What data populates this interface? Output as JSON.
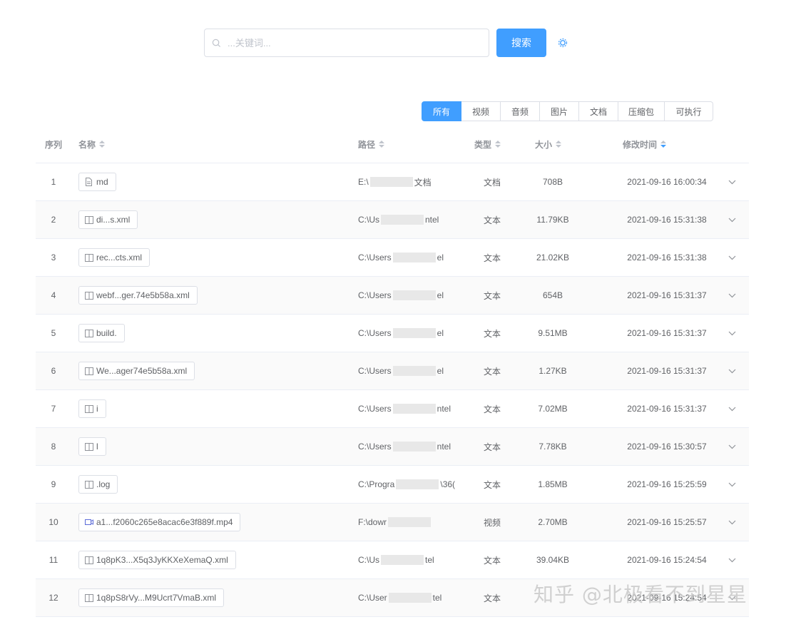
{
  "search": {
    "placeholder": "...关键词...",
    "button_label": "搜索"
  },
  "filters": [
    "所有",
    "视频",
    "音频",
    "图片",
    "文档",
    "压缩包",
    "可执行"
  ],
  "active_filter": "所有",
  "table": {
    "headers": {
      "index": "序列",
      "name": "名称",
      "path": "路径",
      "type": "类型",
      "size": "大小",
      "modified": "修改时间"
    },
    "rows": [
      {
        "idx": "1",
        "icon": "document-icon",
        "name": "md",
        "path": "E:\\",
        "path_tail": "文档",
        "type": "文档",
        "size": "708B",
        "time": "2021-09-16 16:00:34"
      },
      {
        "idx": "2",
        "icon": "text-file-icon",
        "name": "di...s.xml",
        "path": "C:\\Us",
        "path_tail": "ntel",
        "type": "文本",
        "size": "11.79KB",
        "time": "2021-09-16 15:31:38"
      },
      {
        "idx": "3",
        "icon": "text-file-icon",
        "name": "rec...cts.xml",
        "path": "C:\\Users",
        "path_tail": "el",
        "type": "文本",
        "size": "21.02KB",
        "time": "2021-09-16 15:31:38"
      },
      {
        "idx": "4",
        "icon": "text-file-icon",
        "name": "webf...ger.74e5b58a.xml",
        "path": "C:\\Users",
        "path_tail": "el",
        "type": "文本",
        "size": "654B",
        "time": "2021-09-16 15:31:37"
      },
      {
        "idx": "5",
        "icon": "text-file-icon",
        "name": "build.",
        "path": "C:\\Users",
        "path_tail": "el",
        "type": "文本",
        "size": "9.51MB",
        "time": "2021-09-16 15:31:37"
      },
      {
        "idx": "6",
        "icon": "text-file-icon",
        "name": "We...ager74e5b58a.xml",
        "path": "C:\\Users",
        "path_tail": "el",
        "type": "文本",
        "size": "1.27KB",
        "time": "2021-09-16 15:31:37"
      },
      {
        "idx": "7",
        "icon": "text-file-icon",
        "name": "i",
        "path": "C:\\Users",
        "path_tail": "ntel",
        "type": "文本",
        "size": "7.02MB",
        "time": "2021-09-16 15:31:37"
      },
      {
        "idx": "8",
        "icon": "text-file-icon",
        "name": "l",
        "path": "C:\\Users",
        "path_tail": "ntel",
        "type": "文本",
        "size": "7.78KB",
        "time": "2021-09-16 15:30:57"
      },
      {
        "idx": "9",
        "icon": "text-file-icon",
        "name": ".log",
        "path": "C:\\Progra",
        "path_tail": "\\36(",
        "type": "文本",
        "size": "1.85MB",
        "time": "2021-09-16 15:25:59"
      },
      {
        "idx": "10",
        "icon": "video-file-icon",
        "name": "a1...f2060c265e8acac6e3f889f.mp4",
        "path": "F:\\dowr",
        "path_tail": "",
        "type": "视频",
        "size": "2.70MB",
        "time": "2021-09-16 15:25:57"
      },
      {
        "idx": "11",
        "icon": "text-file-icon",
        "name": "1q8pK3...X5q3JyKKXeXemaQ.xml",
        "path": "C:\\Us",
        "path_tail": "tel",
        "type": "文本",
        "size": "39.04KB",
        "time": "2021-09-16 15:24:54"
      },
      {
        "idx": "12",
        "icon": "text-file-icon",
        "name": "1q8pS8rVy...M9Ucrt7VmaB.xml",
        "path": "C:\\User",
        "path_tail": "tel",
        "type": "文本",
        "size": "",
        "time": "2021-09-16 15:24:54"
      }
    ]
  },
  "watermark": "知乎 @北极看不到星星",
  "colors": {
    "primary": "#409eff",
    "border": "#dcdfe6",
    "row_alt": "#fafafa",
    "header_text": "#909399"
  }
}
